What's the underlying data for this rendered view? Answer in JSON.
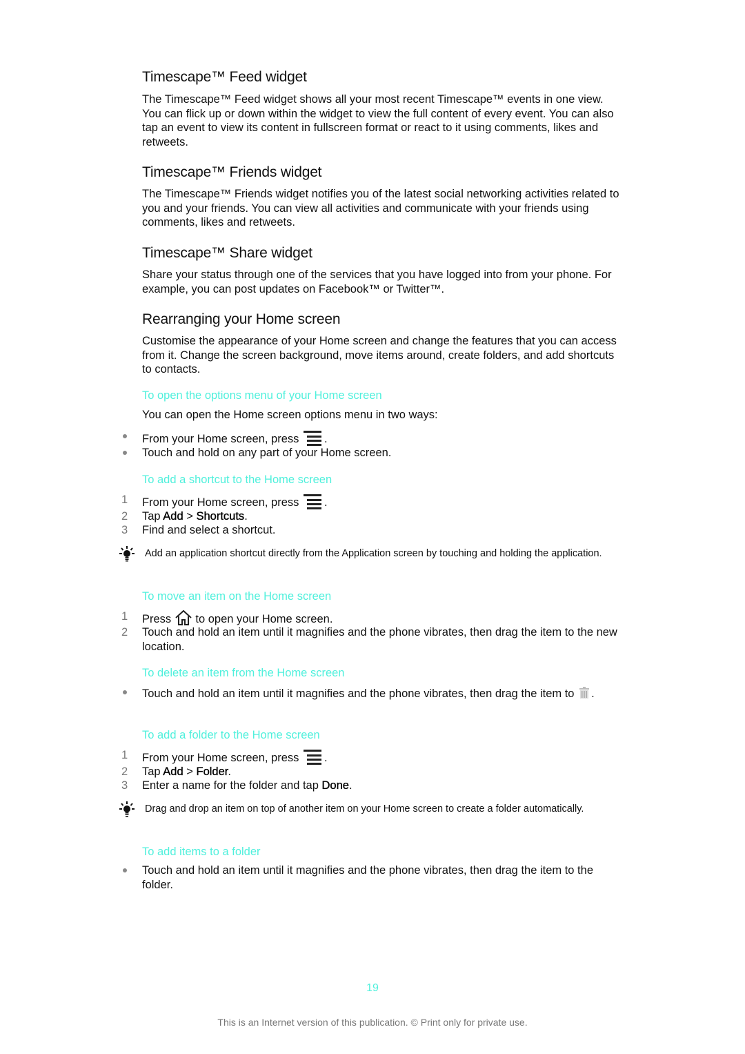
{
  "sections": {
    "feed": {
      "title": "Timescape™ Feed widget",
      "body": "The Timescape™ Feed widget shows all your most recent Timescape™ events in one view. You can flick up or down within the widget to view the full content of every event. You can also tap an event to view its content in fullscreen format or react to it using comments, likes and retweets."
    },
    "friends": {
      "title": "Timescape™ Friends widget",
      "body": "The Timescape™ Friends widget notifies you of the latest social networking activities related to you and your friends. You can view all activities and communicate with your friends using comments, likes and retweets."
    },
    "share": {
      "title": "Timescape™ Share widget",
      "body": "Share your status through one of the services that you have logged into from your phone. For example, you can post updates on Facebook™ or Twitter™."
    },
    "rearrange": {
      "title": "Rearranging your Home screen",
      "body": "Customise the appearance of your Home screen and change the features that you can access from it. Change the screen background, move items around, create folders, and add shortcuts to contacts."
    }
  },
  "procedures": {
    "options_menu": {
      "title": "To open the options menu of your Home screen",
      "intro": "You can open the Home screen options menu in two ways:",
      "bullet1_pre": "From your Home screen, press",
      "bullet1_post": ".",
      "bullet2": "Touch and hold on any part of your Home screen."
    },
    "add_shortcut": {
      "title": "To add a shortcut to the Home screen",
      "steps": [
        {
          "num": "1",
          "pre": "From your Home screen, press",
          "post": "."
        },
        {
          "num": "2",
          "pre": "Tap",
          "b1": "Add",
          "sep": ">",
          "b2": "Shortcuts",
          "post": "."
        },
        {
          "num": "3",
          "text": "Find and select a shortcut."
        }
      ],
      "tip": "Add an application shortcut directly from the Application screen by touching and holding the application."
    },
    "move_item": {
      "title": "To move an item on the Home screen",
      "steps": [
        {
          "num": "1",
          "pre": "Press",
          "post": "to open your Home screen."
        },
        {
          "num": "2",
          "text": "Touch and hold an item until it magnifies and the phone vibrates, then drag the item to the new location."
        }
      ]
    },
    "delete_item": {
      "title": "To delete an item from the Home screen",
      "bullet_pre": "Touch and hold an item until it magnifies and the phone vibrates, then drag the item to",
      "bullet_post": "."
    },
    "add_folder": {
      "title": "To add a folder to the Home screen",
      "steps": [
        {
          "num": "1",
          "pre": "From your Home screen, press",
          "post": "."
        },
        {
          "num": "2",
          "pre": "Tap",
          "b1": "Add",
          "sep": ">",
          "b2": "Folder",
          "post": "."
        },
        {
          "num": "3",
          "pre": "Enter a name for the folder and tap",
          "b1": "Done",
          "post": "."
        }
      ],
      "tip": "Drag and drop an item on top of another item on your Home screen to create a folder automatically."
    },
    "add_items_folder": {
      "title": "To add items to a folder",
      "bullet": "Touch and hold an item until it magnifies and the phone vibrates, then drag the item to the folder."
    }
  },
  "page_number": "19",
  "footer": "This is an Internet version of this publication. © Print only for private use.",
  "colors": {
    "accent": "#4ff0dc",
    "text": "#111111",
    "muted": "#777777"
  }
}
